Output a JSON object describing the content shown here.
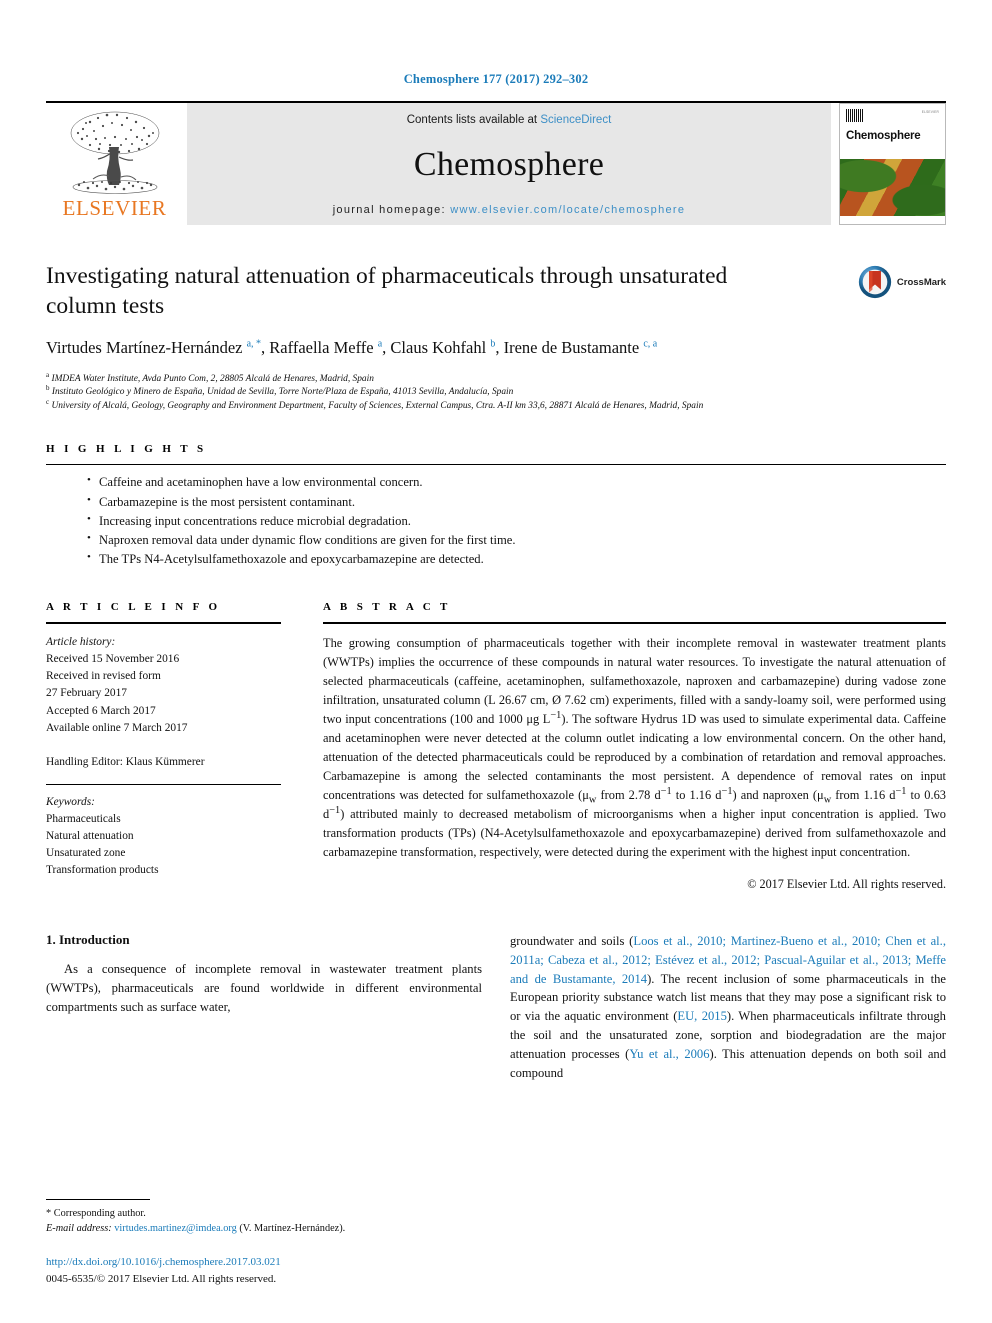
{
  "running_head": "Chemosphere 177 (2017) 292–302",
  "masthead": {
    "publisher_name": "ELSEVIER",
    "contents_prefix": "Contents lists available at ",
    "contents_link": "ScienceDirect",
    "journal_title": "Chemosphere",
    "homepage_prefix": "journal homepage: ",
    "homepage_url": "www.elsevier.com/locate/chemosphere",
    "cover_title": "Chemosphere",
    "cover_corner_text": "ELSEVIER"
  },
  "article": {
    "title": "Investigating natural attenuation of pharmaceuticals through unsaturated column tests",
    "crossmark_label": "CrossMark",
    "authors_html": "Virtudes Martínez-Hernández <sup>a, *</sup>, Raffaella Meffe <sup>a</sup>, Claus Kohfahl <sup>b</sup>, Irene de Bustamante <sup>c, a</sup>",
    "affiliations": [
      "IMDEA Water Institute, Avda Punto Com, 2, 28805 Alcalá de Henares, Madrid, Spain",
      "Instituto Geológico y Minero de España, Unidad de Sevilla, Torre Norte/Plaza de España, 41013 Sevilla, Andalucía, Spain",
      "University of Alcalá, Geology, Geography and Environment Department, Faculty of Sciences, External Campus, Ctra. A-II km 33,6, 28871 Alcalá de Henares, Madrid, Spain"
    ],
    "affiliation_marks": [
      "a",
      "b",
      "c"
    ]
  },
  "highlights": {
    "heading": "H I G H L I G H T S",
    "items": [
      "Caffeine and acetaminophen have a low environmental concern.",
      "Carbamazepine is the most persistent contaminant.",
      "Increasing input concentrations reduce microbial degradation.",
      "Naproxen removal data under dynamic flow conditions are given for the first time.",
      "The TPs N4-Acetylsulfamethoxazole and epoxycarbamazepine are detected."
    ]
  },
  "article_info": {
    "heading": "A R T I C L E   I N F O",
    "history_label": "Article history:",
    "history_lines": [
      "Received 15 November 2016",
      "Received in revised form",
      "27 February 2017",
      "Accepted 6 March 2017",
      "Available online 7 March 2017"
    ],
    "handling_editor": "Handling Editor: Klaus Kümmerer",
    "keywords_label": "Keywords:",
    "keywords": [
      "Pharmaceuticals",
      "Natural attenuation",
      "Unsaturated zone",
      "Transformation products"
    ]
  },
  "abstract": {
    "heading": "A B S T R A C T",
    "paragraph_html": "The growing consumption of pharmaceuticals together with their incomplete removal in wastewater treatment plants (WWTPs) implies the occurrence of these compounds in natural water resources. To investigate the natural attenuation of selected pharmaceuticals (caffeine, acetaminophen, sulfamethoxazole, naproxen and carbamazepine) during vadose zone infiltration, unsaturated column (L 26.67 cm, Ø 7.62 cm) experiments, filled with a sandy-loamy soil, were performed using two input concentrations (100 and 1000 &mu;g L<sup>&minus;1</sup>). The software Hydrus 1D was used to simulate experimental data. Caffeine and acetaminophen were never detected at the column outlet indicating a low environmental concern. On the other hand, attenuation of the detected pharmaceuticals could be reproduced by a combination of retardation and removal approaches. Carbamazepine is among the selected contaminants the most persistent. A dependence of removal rates on input concentrations was detected for sulfamethoxazole (&mu;<sub>w</sub> from 2.78 d<sup>&minus;1</sup> to 1.16 d<sup>&minus;1</sup>) and naproxen (&mu;<sub>w</sub> from 1.16 d<sup>&minus;1</sup> to 0.63 d<sup>&minus;1</sup>) attributed mainly to decreased metabolism of microorganisms when a higher input concentration is applied. Two transformation products (TPs) (N4-Acetylsulfamethoxazole and epoxycarbamazepine) derived from sulfamethoxazole and carbamazepine transformation, respectively, were detected during the experiment with the highest input concentration.",
    "copyright": "© 2017 Elsevier Ltd. All rights reserved."
  },
  "introduction": {
    "heading": "1. Introduction",
    "left_paragraph_html": "As a consequence of incomplete removal in wastewater treatment plants (WWTPs), pharmaceuticals are found worldwide in different environmental compartments such as surface water,",
    "right_paragraph_html": "groundwater and soils (<span class=\"cite\">Loos et al., 2010; Martinez-Bueno et al., 2010; Chen et al., 2011a; Cabeza et al., 2012; Estévez et al., 2012; Pascual-Aguilar et al., 2013; Meffe and de Bustamante, 2014</span>). The recent inclusion of some pharmaceuticals in the European priority substance watch list means that they may pose a significant risk to or via the aquatic environment (<span class=\"cite\">EU, 2015</span>). When pharmaceuticals infiltrate through the soil and the unsaturated zone, sorption and biodegradation are the major attenuation processes (<span class=\"cite\">Yu et al., 2006</span>). This attenuation depends on both soil and compound"
  },
  "footer": {
    "corresponding_author": "* Corresponding author.",
    "email_label": "E-mail address:",
    "email": "virtudes.martinez@imdea.org",
    "email_suffix": "(V. Martínez-Hernández).",
    "doi": "http://dx.doi.org/10.1016/j.chemosphere.2017.03.021",
    "issn": "0045-6535/© 2017 Elsevier Ltd. All rights reserved."
  },
  "colors": {
    "link_blue": "#1a7bb9",
    "elsevier_orange": "#E87722",
    "banner_grey": "#e7e7e7"
  }
}
